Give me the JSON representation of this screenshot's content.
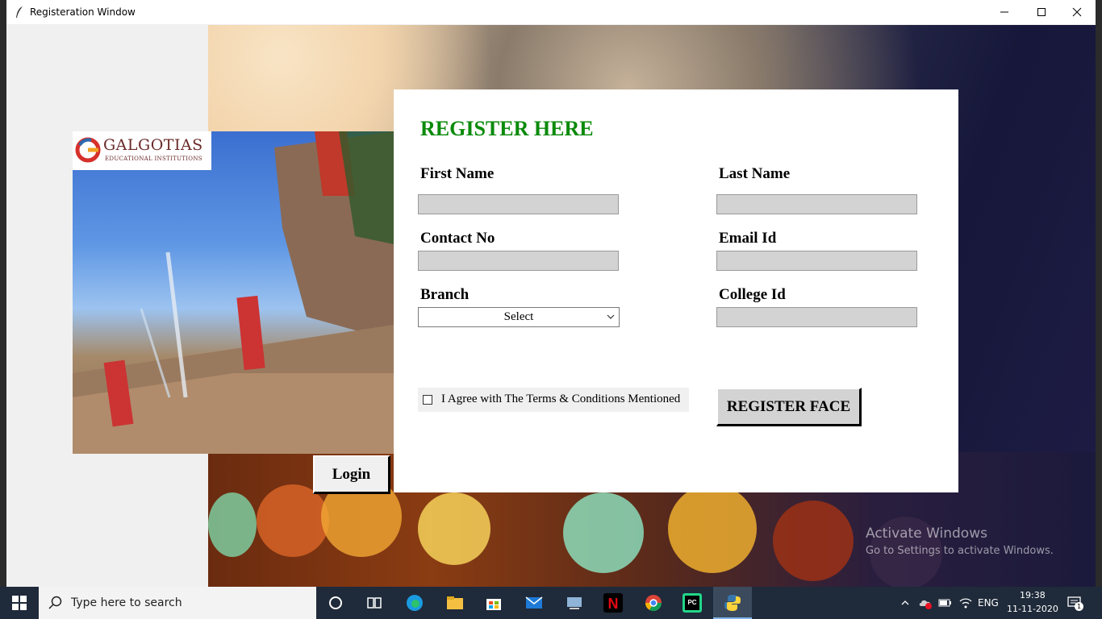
{
  "window": {
    "title": "Registeration Window"
  },
  "left_panel": {
    "logo_name": "GALGOTIAS",
    "logo_sub": "EDUCATIONAL INSTITUTIONS",
    "login_label": "Login"
  },
  "form": {
    "title": "REGISTER HERE",
    "first_name_label": "First Name",
    "last_name_label": "Last Name",
    "contact_label": "Contact No",
    "email_label": "Email Id",
    "branch_label": "Branch",
    "branch_selected": "Select",
    "college_id_label": "College Id",
    "agree_text": "I Agree with The Terms & Conditions Mentioned",
    "agree_checked": false,
    "register_face_label": "REGISTER FACE",
    "values": {
      "first_name": "",
      "last_name": "",
      "contact": "",
      "email": "",
      "college_id": ""
    }
  },
  "watermark": {
    "title": "Activate Windows",
    "subtitle": "Go to Settings to activate Windows."
  },
  "taskbar": {
    "search_placeholder": "Type here to search",
    "language": "ENG",
    "time": "19:38",
    "date": "11-11-2020",
    "notification_count": "1",
    "icons": [
      "cortana-icon",
      "task-view-icon",
      "edge-icon",
      "file-explorer-icon",
      "store-icon",
      "mail-icon",
      "vmware-icon",
      "netflix-icon",
      "chrome-icon",
      "pycharm-icon",
      "python-icon"
    ]
  },
  "colors": {
    "title_green": "#0a8a0a",
    "input_gray": "#d3d3d3",
    "taskbar": "#1f2a3a"
  }
}
